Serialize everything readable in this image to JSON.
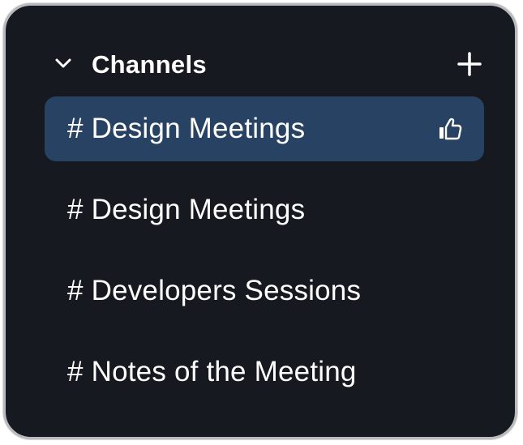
{
  "header": {
    "title": "Channels",
    "collapse_icon": "chevron-down-icon",
    "add_icon": "plus-icon"
  },
  "channels": [
    {
      "label": "# Design Meetings",
      "active": true,
      "icon": "thumbs-up-icon"
    },
    {
      "label": "# Design Meetings",
      "active": false
    },
    {
      "label": "# Developers Sessions",
      "active": false
    },
    {
      "label": "# Notes of the Meeting",
      "active": false
    }
  ],
  "colors": {
    "panel_background": "#16191f",
    "active_item": "#284264",
    "text": "#ffffff",
    "border": "#b8babd"
  }
}
